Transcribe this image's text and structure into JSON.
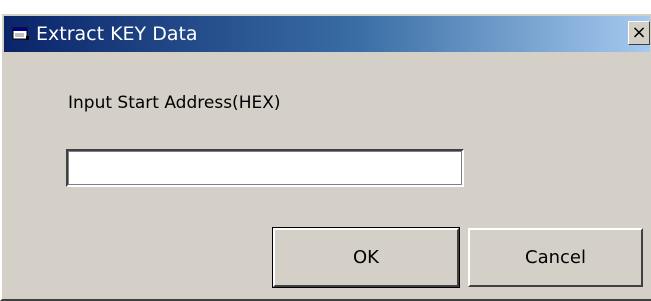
{
  "window": {
    "title": "Extract KEY Data",
    "close_label": "×"
  },
  "dialog": {
    "prompt_label": "Input Start Address(HEX)",
    "address_value": "",
    "ok_label": "OK",
    "cancel_label": "Cancel"
  },
  "colors": {
    "titlebar_start": "#0a246a",
    "titlebar_end": "#a6caf0",
    "face": "#d4d0c8"
  },
  "icons": {
    "title_icon": "window-app-icon",
    "close_icon": "close-icon"
  }
}
